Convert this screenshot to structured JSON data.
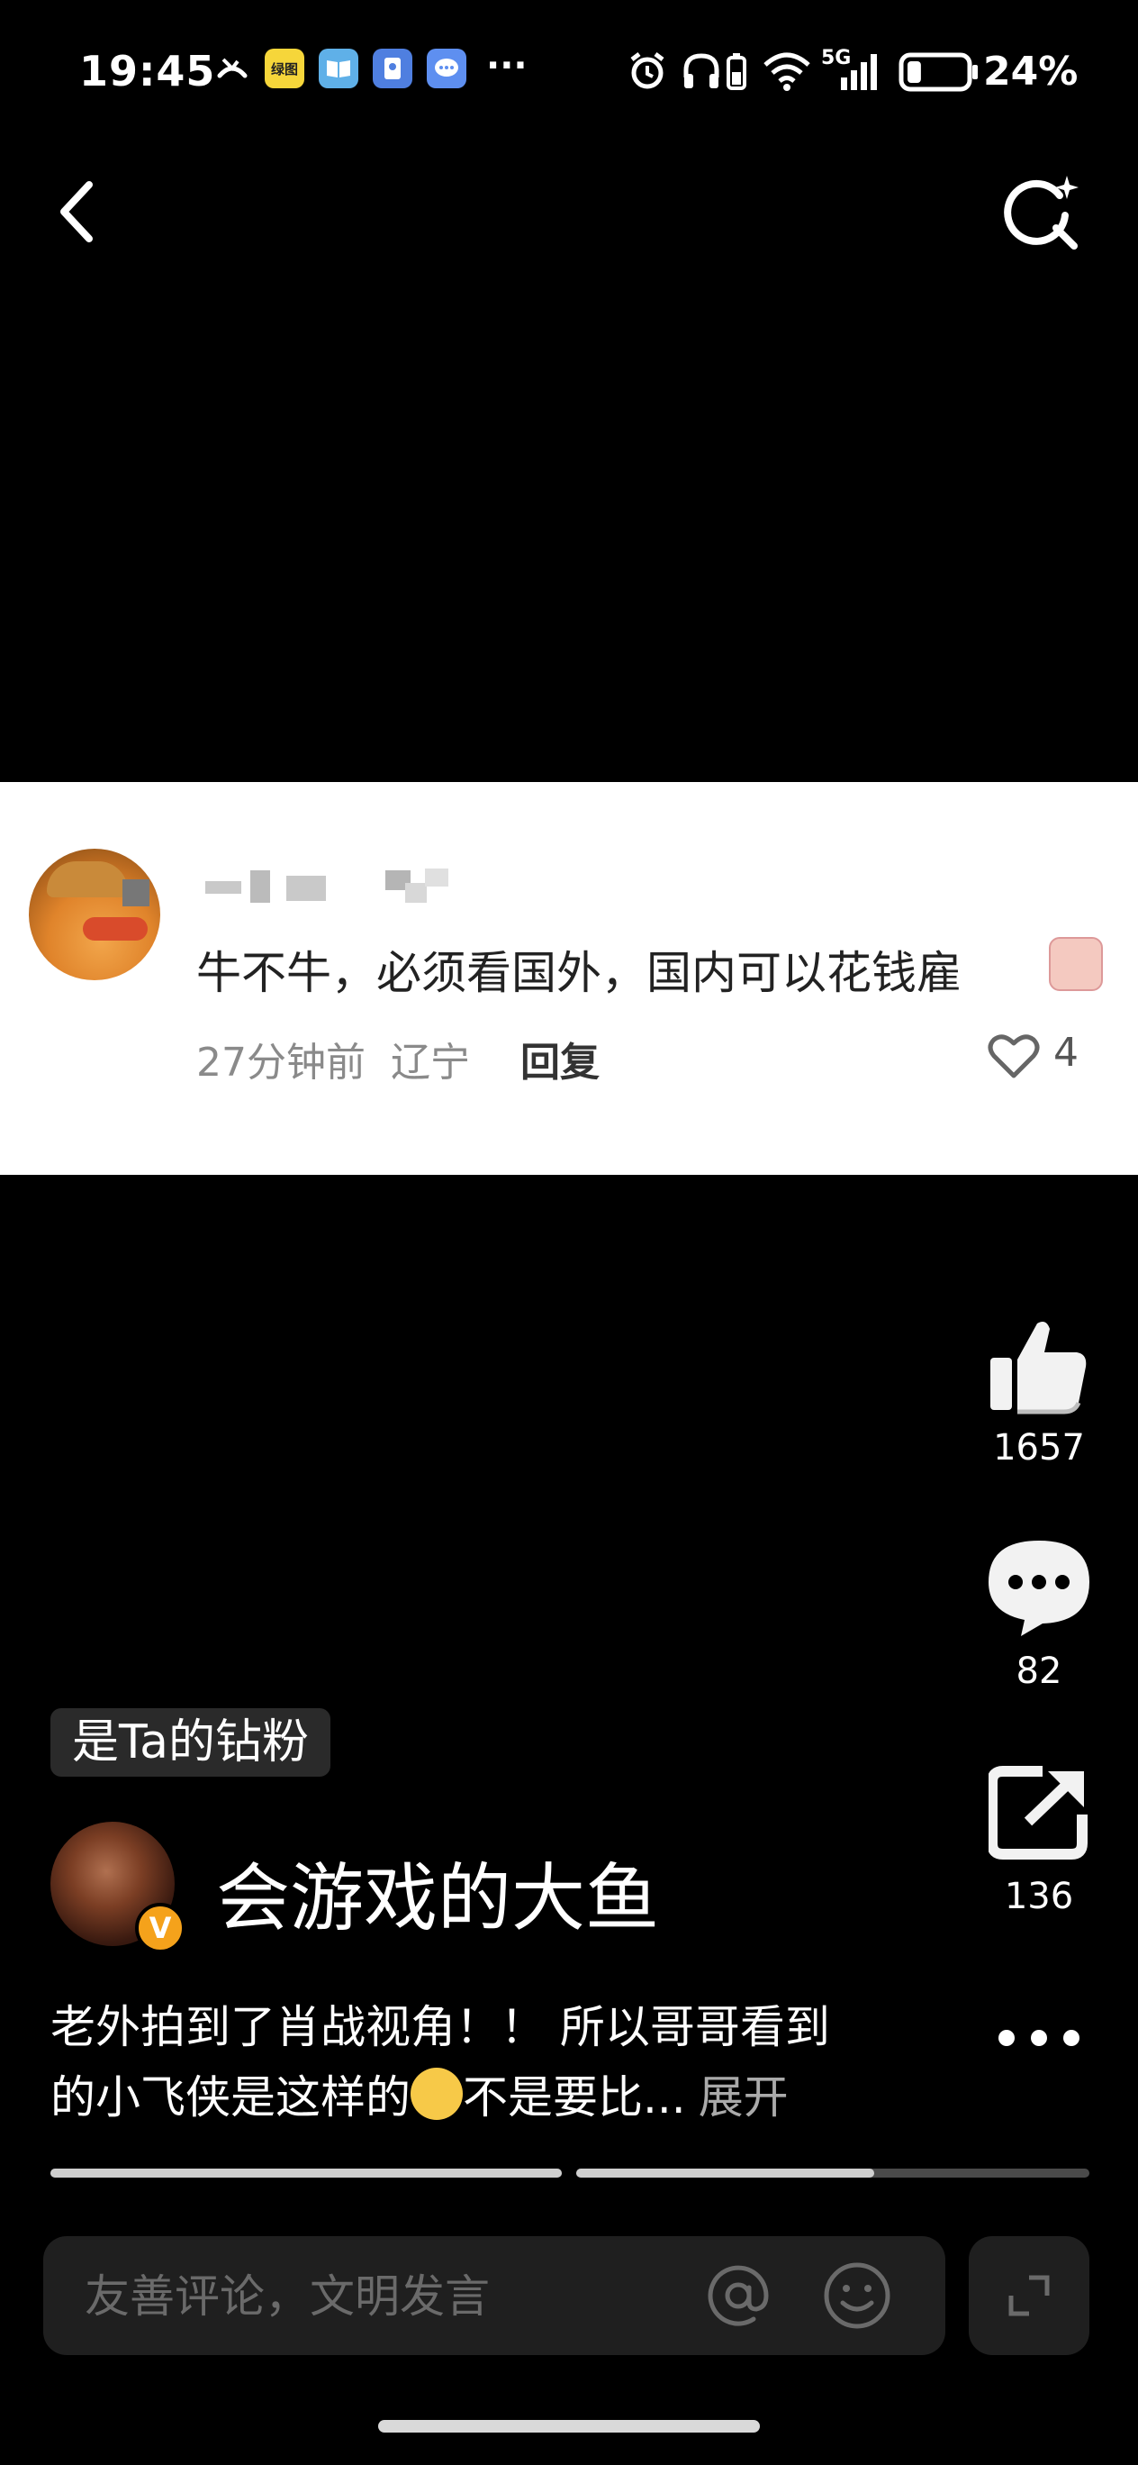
{
  "status_bar": {
    "time": "19:45",
    "app_icons": [
      {
        "name": "green-app-icon",
        "label": "绿图",
        "color": "#f6d63a"
      },
      {
        "name": "book-app-icon",
        "label": "",
        "color": "#5fb0e8"
      },
      {
        "name": "dict-app-icon",
        "label": "",
        "color": "#4f7fe0"
      },
      {
        "name": "message-app-icon",
        "label": "",
        "color": "#5e8ff0"
      }
    ],
    "more": "···",
    "network": "5G",
    "battery_percent": "24%",
    "battery_level": 0.24
  },
  "header": {
    "back_icon": "chevron-left-icon",
    "search_icon": "search-sparkle-icon"
  },
  "comment": {
    "text": "牛不牛，必须看国外，国内可以花钱雇",
    "time": "27分钟前",
    "location": "辽宁",
    "reply_label": "回复",
    "like_count": "4"
  },
  "actions": {
    "like_count": "1657",
    "comment_count": "82",
    "share_count": "136"
  },
  "post": {
    "fan_badge": "是Ta的钻粉",
    "author_name": "会游戏的大鱼",
    "verified_badge": "V",
    "description_line1": "老外拍到了肖战视角！！ 所以哥哥看到",
    "description_line2_a": "的小飞侠是这样的",
    "description_line2_b": "不是要比...",
    "expand_label": "展开"
  },
  "progress": {
    "segments": [
      1.0,
      0.58
    ]
  },
  "comment_bar": {
    "placeholder": "友善评论，文明发言"
  }
}
